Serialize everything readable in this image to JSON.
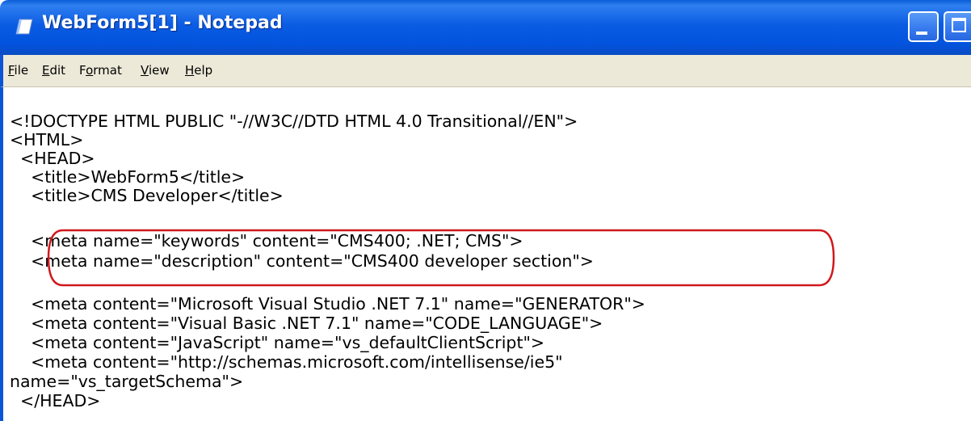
{
  "window": {
    "title": "WebForm5[1] - Notepad",
    "icon": "notepad-icon"
  },
  "menu": {
    "items": [
      {
        "first": "F",
        "rest": "ile"
      },
      {
        "first": "E",
        "rest": "dit"
      },
      {
        "pre": "F",
        "first": "o",
        "rest": "rmat"
      },
      {
        "first": "V",
        "rest": "iew"
      },
      {
        "first": "H",
        "rest": "elp"
      }
    ]
  },
  "document": {
    "lines": [
      "<!DOCTYPE HTML PUBLIC \"-//W3C//DTD HTML 4.0 Transitional//EN\">",
      "<HTML>",
      "  <HEAD>",
      "    <title>WebForm5</title>",
      "    <title>CMS Developer</title>",
      "",
      "    <meta name=\"keywords\" content=\"CMS400; .NET; CMS\">",
      "    <meta name=\"description\" content=\"CMS400 developer section\">",
      "",
      "    <meta content=\"Microsoft Visual Studio .NET 7.1\" name=\"GENERATOR\">",
      "    <meta content=\"Visual Basic .NET 7.1\" name=\"CODE_LANGUAGE\">",
      "    <meta content=\"JavaScript\" name=\"vs_defaultClientScript\">",
      "    <meta content=\"http://schemas.microsoft.com/intellisense/ie5\"",
      "name=\"vs_targetSchema\">",
      "  </HEAD>"
    ]
  },
  "colors": {
    "titlebar": "#0b5ce3",
    "menubar": "#ece9d8",
    "highlight": "#d0181c"
  }
}
